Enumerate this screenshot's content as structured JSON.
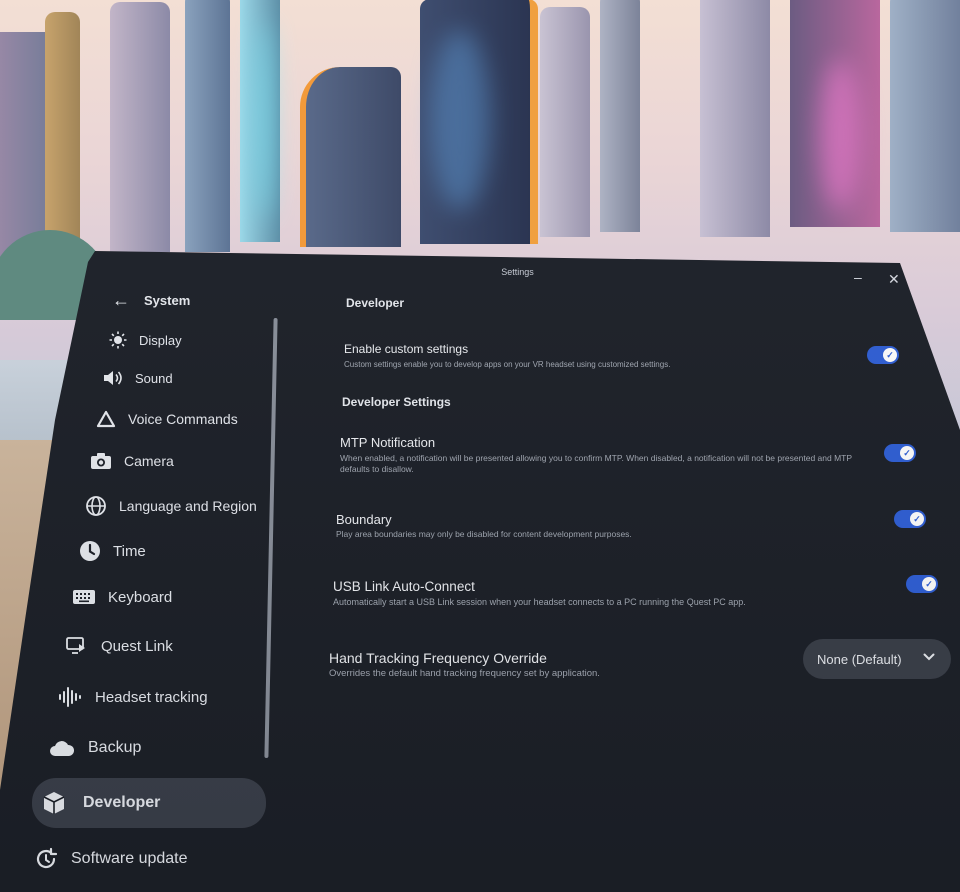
{
  "window": {
    "title": "Settings",
    "minimize_icon": "minimize-icon",
    "close_icon": "close-icon"
  },
  "sidebar": {
    "back_label": "System",
    "items": [
      {
        "label": "Display",
        "icon": "brightness-icon"
      },
      {
        "label": "Sound",
        "icon": "speaker-icon"
      },
      {
        "label": "Voice Commands",
        "icon": "voice-commands-icon"
      },
      {
        "label": "Camera",
        "icon": "camera-icon"
      },
      {
        "label": "Language and Region",
        "icon": "globe-icon"
      },
      {
        "label": "Time",
        "icon": "clock-icon"
      },
      {
        "label": "Keyboard",
        "icon": "keyboard-icon"
      },
      {
        "label": "Quest Link",
        "icon": "quest-link-icon"
      },
      {
        "label": "Headset tracking",
        "icon": "tracking-icon"
      },
      {
        "label": "Backup",
        "icon": "cloud-icon"
      },
      {
        "label": "Developer",
        "icon": "cube-icon",
        "selected": true
      },
      {
        "label": "Software update",
        "icon": "update-icon"
      }
    ]
  },
  "content": {
    "section_title": "Developer",
    "custom": {
      "title": "Enable custom settings",
      "desc": "Custom settings enable you to develop apps on your VR headset using customized settings.",
      "enabled": true
    },
    "subsection_title": "Developer Settings",
    "mtp": {
      "title": "MTP Notification",
      "desc": "When enabled, a notification will be presented allowing you to confirm MTP. When disabled, a notification will not be presented and MTP defaults to disallow.",
      "enabled": true
    },
    "boundary": {
      "title": "Boundary",
      "desc": "Play area boundaries may only be disabled for content development purposes.",
      "enabled": true
    },
    "usb": {
      "title": "USB Link Auto-Connect",
      "desc": "Automatically start a USB Link session when your headset connects to a PC running the Quest PC app.",
      "enabled": true
    },
    "hand_tracking": {
      "title": "Hand Tracking Frequency Override",
      "desc": "Overrides the default hand tracking frequency set by application.",
      "selected": "None (Default)"
    }
  },
  "colors": {
    "toggle_on": "#2f5fd6",
    "panel_bg": "#1c2028",
    "selected_bg": "#3a3f4a"
  }
}
